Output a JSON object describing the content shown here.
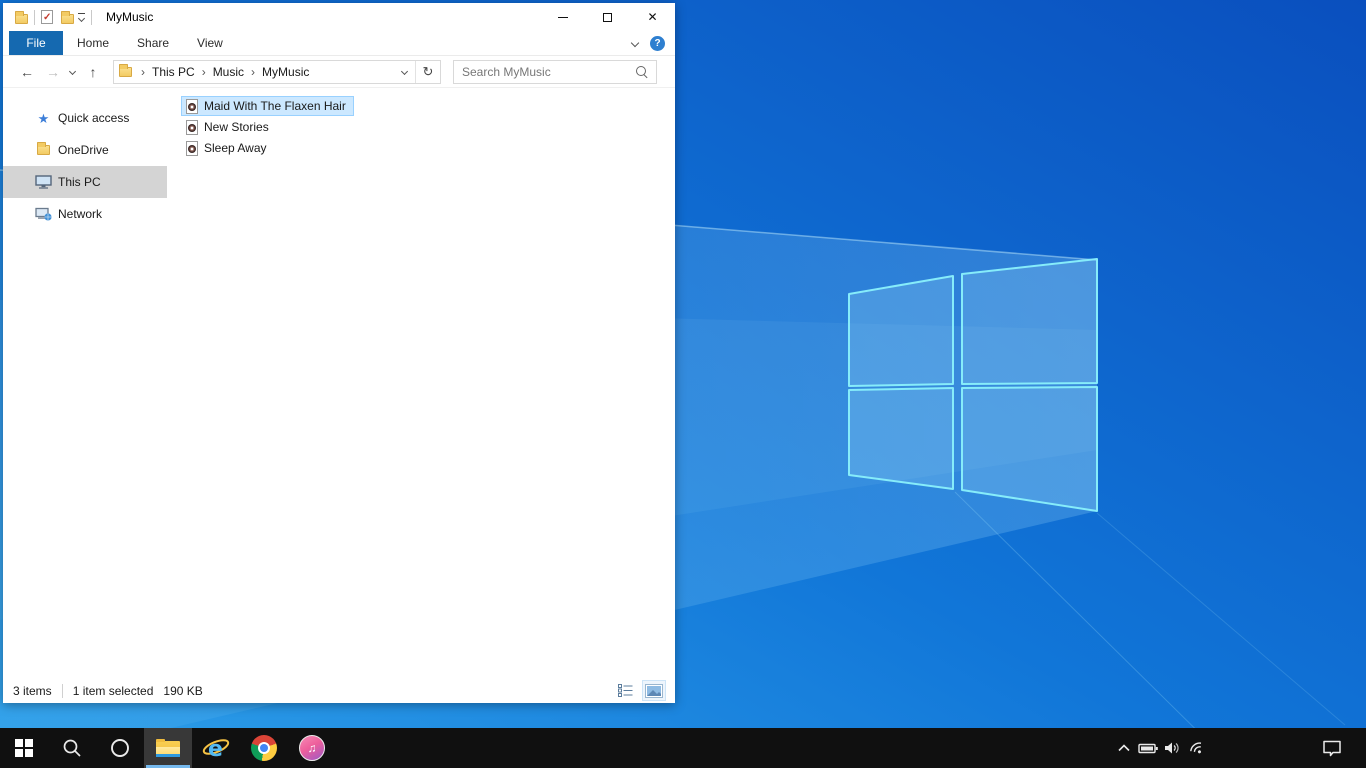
{
  "window": {
    "title": "MyMusic",
    "caption_buttons": {
      "minimize": "minimize",
      "maximize": "maximize",
      "close_glyph": "✕"
    }
  },
  "ribbon": {
    "tabs": [
      "File",
      "Home",
      "Share",
      "View"
    ],
    "active_tab": "File",
    "help_glyph": "?"
  },
  "navbar": {
    "back_glyph": "←",
    "forward_glyph": "→",
    "up_glyph": "↑",
    "refresh_glyph": "↻",
    "breadcrumb": [
      "This PC",
      "Music",
      "MyMusic"
    ],
    "breadcrumb_separator": "›",
    "search_placeholder": "Search MyMusic"
  },
  "sidebar": [
    {
      "label": "Quick access",
      "icon": "quick-access-icon",
      "selected": false
    },
    {
      "label": "OneDrive",
      "icon": "onedrive-icon",
      "selected": false
    },
    {
      "label": "This PC",
      "icon": "this-pc-icon",
      "selected": true
    },
    {
      "label": "Network",
      "icon": "network-icon",
      "selected": false
    }
  ],
  "files": [
    {
      "name": "Maid With The Flaxen Hair",
      "icon": "music-file-icon",
      "selected": true
    },
    {
      "name": "New Stories",
      "icon": "music-file-icon",
      "selected": false
    },
    {
      "name": "Sleep Away",
      "icon": "music-file-icon",
      "selected": false
    }
  ],
  "statusbar": {
    "count": "3 items",
    "selection": "1 item selected",
    "size": "190 KB",
    "views": [
      "details-view",
      "large-thumbnails-view"
    ],
    "active_view": "large-thumbnails-view"
  },
  "taskbar": {
    "apps": [
      "start",
      "search",
      "cortana",
      "file-explorer",
      "internet-explorer",
      "chrome",
      "itunes"
    ],
    "active_app": "file-explorer",
    "ie_glyph": "e",
    "itunes_glyph": "♫",
    "tray": [
      "hidden-icons",
      "battery",
      "volume",
      "wifi",
      "action-center"
    ]
  },
  "colors": {
    "accent_file_tab": "#1569b0",
    "selection_bg": "#cce8ff",
    "selection_border": "#99d1ff",
    "sidebar_selected_bg": "#d4d4d4",
    "taskbar_bg": "#101010",
    "taskbar_underline": "#76b9ed",
    "wallpaper_light": "#2fa1ea",
    "wallpaper_dark": "#0a4fbe",
    "logo_edge": "#86ecfa"
  }
}
